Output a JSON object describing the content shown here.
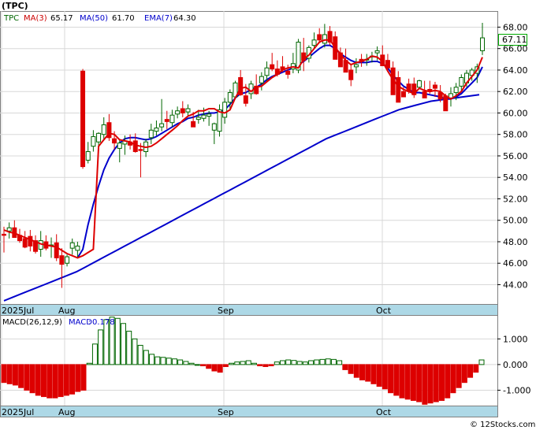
{
  "header": {
    "ticker": "(TPC)",
    "ticker_code": "TPC",
    "ma3_label": "MA(3)",
    "ma3_value": "65.17",
    "ma50_label": "MA(50)",
    "ma50_value": "61.70",
    "ema7_label": "EMA(7)",
    "ema7_value": "64.30",
    "last_price": "67.11"
  },
  "macd_header": {
    "params": "MACD(26,12,9)",
    "label": "MACD",
    "value": "0.178"
  },
  "footer": {
    "copyright": "© 12Stocks.com"
  },
  "colors": {
    "ma3": "#dd0000",
    "ma50": "#0000cc",
    "ema7": "#0000cc",
    "up_candle": "#ffffff",
    "down_candle": "#dd0000",
    "candle_outline": "#006600",
    "date_band": "#add8e6",
    "macd_pos": "#ffffff",
    "macd_pos_outline": "#006600",
    "macd_neg": "#dd0000"
  },
  "chart_data": [
    {
      "type": "candlestick",
      "y_ticks": [
        "68.00",
        "66.00",
        "64.00",
        "62.00",
        "60.00",
        "58.00",
        "56.00",
        "54.00",
        "52.00",
        "50.00",
        "48.00",
        "46.00",
        "44.00"
      ],
      "ylim": [
        42.2,
        69.5
      ],
      "x_labels": [
        "2025Jul",
        "Aug",
        "Sep",
        "Oct"
      ],
      "candles": [
        [
          48.7,
          49.4,
          47.0,
          48.6
        ],
        [
          49.0,
          49.8,
          48.3,
          49.3
        ],
        [
          49.3,
          50.0,
          48.5,
          48.4
        ],
        [
          48.6,
          49.2,
          47.9,
          48.1
        ],
        [
          48.3,
          49.0,
          47.4,
          47.5
        ],
        [
          48.5,
          49.1,
          47.1,
          47.6
        ],
        [
          48.1,
          48.6,
          46.9,
          47.1
        ],
        [
          47.3,
          49.0,
          46.6,
          48.1
        ],
        [
          48.0,
          48.6,
          47.2,
          47.4
        ],
        [
          47.6,
          48.4,
          46.5,
          47.7
        ],
        [
          47.9,
          48.7,
          46.2,
          46.5
        ],
        [
          46.7,
          47.4,
          43.7,
          45.9
        ],
        [
          46.0,
          46.8,
          45.7,
          46.6
        ],
        [
          47.4,
          48.3,
          46.8,
          47.9
        ],
        [
          47.2,
          48.0,
          46.5,
          47.6
        ],
        [
          63.9,
          64.1,
          54.8,
          55.0
        ],
        [
          55.6,
          57.3,
          55.3,
          56.4
        ],
        [
          56.9,
          58.4,
          56.4,
          57.8
        ],
        [
          57.3,
          58.2,
          56.7,
          58.1
        ],
        [
          58.0,
          59.6,
          57.5,
          58.9
        ],
        [
          59.1,
          59.9,
          57.4,
          57.7
        ],
        [
          57.6,
          58.3,
          56.6,
          57.2
        ],
        [
          56.7,
          57.6,
          55.4,
          57.2
        ],
        [
          57.1,
          57.9,
          56.1,
          57.4
        ],
        [
          57.3,
          58.0,
          56.6,
          57.0
        ],
        [
          57.4,
          58.1,
          56.3,
          56.4
        ],
        [
          56.6,
          57.2,
          54.0,
          56.5
        ],
        [
          56.4,
          57.6,
          55.9,
          57.3
        ],
        [
          57.7,
          59.0,
          57.1,
          58.4
        ],
        [
          58.3,
          59.3,
          57.9,
          58.6
        ],
        [
          58.7,
          61.3,
          58.3,
          59.0
        ],
        [
          59.4,
          60.2,
          58.5,
          59.2
        ],
        [
          59.1,
          60.3,
          58.7,
          59.8
        ],
        [
          59.9,
          60.6,
          59.5,
          60.2
        ],
        [
          60.4,
          61.1,
          59.6,
          60.0
        ],
        [
          60.1,
          60.8,
          59.7,
          60.4
        ],
        [
          59.2,
          60.1,
          58.9,
          58.7
        ],
        [
          59.4,
          60.3,
          59.0,
          59.6
        ],
        [
          59.5,
          60.5,
          59.2,
          59.8
        ],
        [
          59.7,
          60.2,
          58.8,
          59.9
        ],
        [
          58.4,
          59.1,
          57.1,
          59.0
        ],
        [
          58.3,
          60.8,
          57.8,
          60.3
        ],
        [
          59.6,
          61.4,
          59.0,
          61.0
        ],
        [
          61.0,
          62.2,
          60.4,
          61.9
        ],
        [
          61.5,
          63.0,
          61.3,
          62.8
        ],
        [
          63.3,
          64.0,
          61.6,
          61.7
        ],
        [
          61.6,
          62.7,
          60.6,
          60.9
        ],
        [
          61.8,
          63.0,
          61.3,
          62.7
        ],
        [
          62.5,
          63.6,
          61.7,
          61.8
        ],
        [
          62.8,
          63.8,
          62.1,
          63.4
        ],
        [
          63.5,
          64.8,
          62.9,
          64.2
        ],
        [
          64.5,
          65.6,
          63.9,
          64.1
        ],
        [
          64.1,
          64.9,
          63.4,
          63.6
        ],
        [
          64.3,
          65.3,
          63.8,
          64.0
        ],
        [
          63.9,
          64.5,
          63.2,
          63.6
        ],
        [
          64.1,
          65.6,
          63.7,
          64.6
        ],
        [
          64.0,
          66.9,
          63.7,
          66.6
        ],
        [
          65.6,
          67.0,
          63.9,
          64.9
        ],
        [
          65.1,
          66.3,
          64.7,
          66.1
        ],
        [
          66.3,
          67.5,
          66.0,
          66.8
        ],
        [
          67.3,
          67.9,
          66.5,
          66.8
        ],
        [
          66.5,
          68.3,
          66.1,
          67.3
        ],
        [
          67.6,
          68.1,
          66.3,
          66.6
        ],
        [
          67.1,
          67.6,
          65.6,
          65.0
        ],
        [
          65.6,
          66.1,
          64.5,
          64.3
        ],
        [
          64.9,
          66.0,
          64.2,
          63.8
        ],
        [
          64.0,
          64.6,
          62.5,
          63.1
        ],
        [
          64.3,
          65.1,
          63.7,
          64.5
        ],
        [
          65.0,
          65.5,
          64.3,
          64.8
        ],
        [
          65.0,
          65.5,
          64.4,
          65.0
        ],
        [
          65.3,
          65.7,
          64.7,
          65.3
        ],
        [
          65.6,
          66.2,
          64.9,
          65.8
        ],
        [
          65.4,
          66.3,
          64.5,
          64.4
        ],
        [
          64.9,
          65.5,
          64.0,
          64.2
        ],
        [
          64.2,
          64.8,
          63.7,
          61.7
        ],
        [
          63.3,
          63.9,
          61.1,
          61.0
        ],
        [
          62.0,
          62.4,
          61.7,
          61.5
        ],
        [
          62.7,
          63.2,
          61.8,
          62.0
        ],
        [
          62.7,
          63.3,
          61.4,
          61.7
        ],
        [
          62.4,
          63.1,
          62.2,
          63.0
        ],
        [
          62.0,
          63.0,
          61.6,
          61.4
        ],
        [
          62.2,
          63.0,
          61.8,
          62.0
        ],
        [
          62.6,
          62.9,
          61.5,
          62.3
        ],
        [
          61.9,
          62.6,
          61.0,
          61.3
        ],
        [
          61.6,
          61.8,
          60.3,
          60.2
        ],
        [
          61.4,
          62.4,
          60.6,
          61.8
        ],
        [
          61.9,
          62.8,
          61.2,
          62.4
        ],
        [
          62.5,
          63.6,
          62.0,
          63.3
        ],
        [
          62.8,
          64.0,
          62.4,
          63.7
        ],
        [
          63.5,
          64.2,
          63.0,
          64.0
        ],
        [
          63.7,
          64.6,
          62.8,
          64.3
        ],
        [
          65.8,
          68.4,
          65.4,
          67.0
        ]
      ],
      "ma3": [
        49.1,
        48.9,
        48.8,
        48.6,
        48.4,
        48.2,
        48.0,
        47.8,
        47.7,
        47.6,
        47.5,
        47.2,
        46.9,
        46.7,
        46.5,
        46.7,
        47.0,
        47.3,
        56.9,
        57.5,
        58.1,
        58.0,
        57.5,
        57.4,
        57.3,
        57.0,
        56.9,
        56.8,
        56.9,
        57.2,
        57.6,
        58.0,
        58.4,
        58.8,
        59.3,
        59.7,
        59.9,
        60.2,
        60.2,
        60.4,
        60.4,
        60.1,
        60.0,
        60.3,
        61.4,
        62.3,
        62.4,
        62.0,
        62.4,
        62.5,
        62.9,
        63.3,
        63.6,
        64.0,
        64.2,
        64.3,
        64.2,
        65.0,
        65.4,
        66.0,
        66.6,
        66.8,
        66.8,
        66.1,
        65.5,
        64.9,
        64.5,
        64.7,
        64.8,
        65.0,
        65.3,
        65.2,
        64.8,
        63.9,
        63.1,
        62.5,
        62.2,
        62.0,
        61.8,
        62.3,
        62.1,
        62.0,
        62.1,
        62.0,
        61.6,
        61.3,
        61.6,
        62.0,
        62.8,
        63.4,
        64.0,
        65.2
      ],
      "ema7": [
        null,
        null,
        null,
        null,
        null,
        null,
        null,
        null,
        null,
        null,
        null,
        null,
        null,
        null,
        46.5,
        47.3,
        49.6,
        51.5,
        53.2,
        54.7,
        55.8,
        56.6,
        57.2,
        57.6,
        57.7,
        57.7,
        57.6,
        57.5,
        57.6,
        57.8,
        58.1,
        58.4,
        58.7,
        59.0,
        59.2,
        59.5,
        59.6,
        59.8,
        59.9,
        60.0,
        60.0,
        60.1,
        60.3,
        60.8,
        61.4,
        61.8,
        61.9,
        62.2,
        62.4,
        62.7,
        63.1,
        63.4,
        63.6,
        63.8,
        64.0,
        64.2,
        64.5,
        64.8,
        65.2,
        65.6,
        66.0,
        66.3,
        66.3,
        66.0,
        65.5,
        65.2,
        64.9,
        64.7,
        64.7,
        64.7,
        64.8,
        64.8,
        64.6,
        64.2,
        63.5,
        63.0,
        62.5,
        62.2,
        61.9,
        61.9,
        61.8,
        61.7,
        61.6,
        61.5,
        61.3,
        61.3,
        61.5,
        61.8,
        62.3,
        62.8,
        63.3,
        64.3
      ],
      "ma50": [
        42.5,
        42.8,
        43.1,
        43.4,
        43.7,
        44.0,
        44.3,
        44.6,
        44.9,
        45.2,
        45.6,
        46.0,
        46.4,
        46.8,
        47.2,
        47.6,
        48.0,
        48.4,
        48.8,
        49.2,
        49.6,
        50.0,
        50.4,
        50.8,
        51.2,
        51.6,
        52.0,
        52.4,
        52.8,
        53.2,
        53.6,
        54.0,
        54.4,
        54.8,
        55.2,
        55.6,
        56.0,
        56.4,
        56.8,
        57.2,
        57.6,
        57.9,
        58.2,
        58.5,
        58.8,
        59.1,
        59.4,
        59.7,
        60.0,
        60.3,
        60.5,
        60.7,
        60.9,
        61.1,
        61.2,
        61.3,
        61.4,
        61.5,
        61.6,
        61.7
      ],
      "macd_ylim": [
        -1.6,
        1.9
      ],
      "macd_ticks": [
        "1.000",
        "0.000",
        "-1.000"
      ],
      "macd": [
        -0.7,
        -0.75,
        -0.8,
        -0.9,
        -1.0,
        -1.1,
        -1.2,
        -1.25,
        -1.3,
        -1.3,
        -1.25,
        -1.2,
        -1.15,
        -1.05,
        -1.0,
        0.05,
        0.8,
        1.35,
        1.75,
        1.85,
        1.8,
        1.6,
        1.3,
        1.0,
        0.75,
        0.55,
        0.4,
        0.3,
        0.28,
        0.25,
        0.22,
        0.18,
        0.12,
        0.05,
        0.0,
        -0.05,
        -0.15,
        -0.25,
        -0.3,
        -0.08,
        0.05,
        0.1,
        0.12,
        0.15,
        0.05,
        -0.05,
        -0.08,
        -0.05,
        0.1,
        0.15,
        0.18,
        0.16,
        0.12,
        0.1,
        0.15,
        0.18,
        0.2,
        0.22,
        0.2,
        0.15,
        -0.2,
        -0.35,
        -0.5,
        -0.6,
        -0.65,
        -0.75,
        -0.85,
        -0.95,
        -1.1,
        -1.2,
        -1.3,
        -1.35,
        -1.4,
        -1.45,
        -1.55,
        -1.5,
        -1.45,
        -1.4,
        -1.3,
        -1.1,
        -0.9,
        -0.7,
        -0.5,
        -0.3,
        0.18
      ]
    }
  ]
}
